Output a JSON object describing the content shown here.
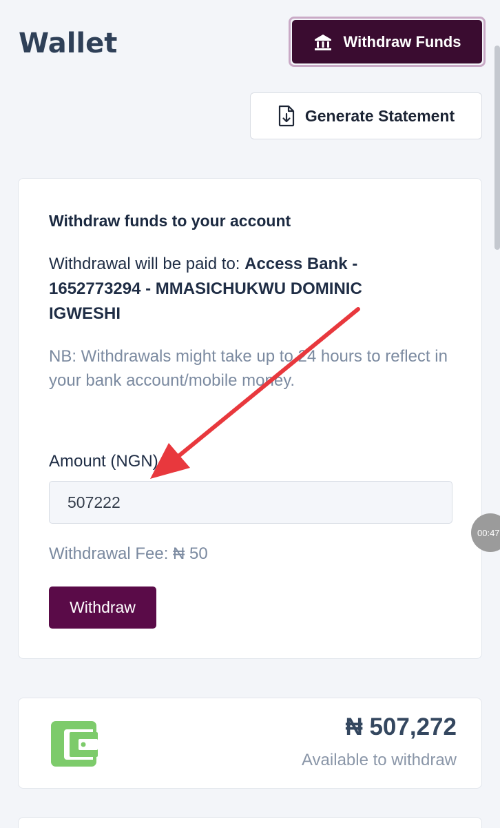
{
  "header": {
    "title": "Wallet",
    "withdraw_funds_label": "Withdraw Funds",
    "generate_statement_label": "Generate Statement"
  },
  "withdraw_card": {
    "heading": "Withdraw funds to your account",
    "paid_to_prefix": "Withdrawal will be paid to: ",
    "paid_to_account": "Access Bank - 1652773294 - MMASICHUKWU DOMINIC IGWESHI",
    "note": "NB: Withdrawals might take up to 24 hours to reflect in your bank account/mobile money.",
    "amount_label": "Amount (NGN)",
    "amount_value": "507222",
    "fee_text": "Withdrawal Fee: ₦ 50",
    "withdraw_button_label": "Withdraw"
  },
  "balance": {
    "amount": "₦ 507,272",
    "caption": "Available to withdraw"
  },
  "overlay": {
    "timer_text": "00:47"
  },
  "colors": {
    "brand_dark": "#3a0c30",
    "brand_button": "#5a0b48",
    "wallet_green": "#7dcb6b",
    "annotation_arrow": "#e8383d"
  },
  "icons": {
    "withdraw_funds": "bank-icon",
    "generate_statement": "file-download-icon",
    "balance": "wallet-icon"
  }
}
